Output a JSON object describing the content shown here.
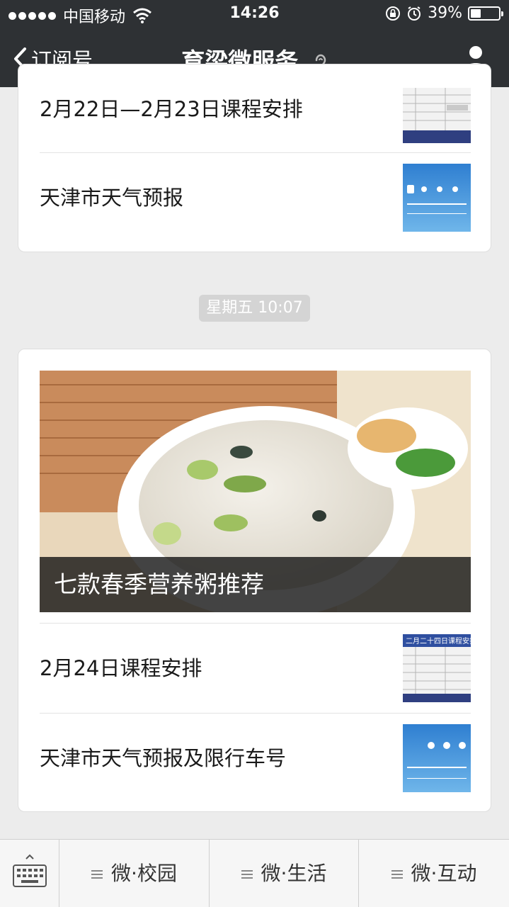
{
  "status_bar": {
    "carrier": "中国移动",
    "time": "14:26",
    "battery": "39%"
  },
  "nav": {
    "back_label": "订阅号",
    "title": "育梁微服务"
  },
  "card1": {
    "items": [
      {
        "title": "2月22日—2月23日课程安排"
      },
      {
        "title": "天津市天气预报"
      }
    ]
  },
  "timestamp": "星期五 10:07",
  "card2": {
    "cover_title": "七款春季营养粥推荐",
    "items": [
      {
        "title": "2月24日课程安排",
        "thumb_heading": "二月二十四日课程安排"
      },
      {
        "title": "天津市天气预报及限行车号"
      }
    ]
  },
  "bottom_menu": {
    "items": [
      {
        "label": "微·校园"
      },
      {
        "label": "微·生活"
      },
      {
        "label": "微·互动"
      }
    ]
  },
  "icons": {
    "back": "chevron-left-icon",
    "ear": "ear-icon",
    "user": "user-icon",
    "keyboard": "keyboard-icon",
    "menu": "hamburger-icon"
  },
  "colors": {
    "nav_bg": "#2e3134",
    "page_bg": "#ececec",
    "card_bg": "#ffffff"
  }
}
